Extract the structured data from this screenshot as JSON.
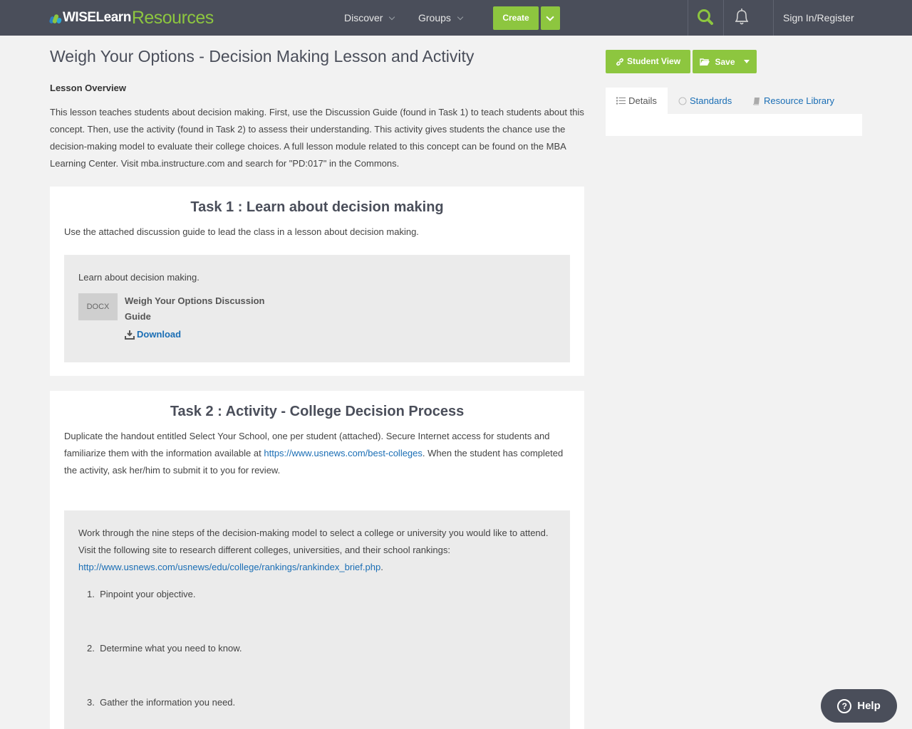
{
  "header": {
    "logo_wise": "WISELearn",
    "logo_resources": "Resources",
    "nav": [
      {
        "label": "Discover"
      },
      {
        "label": "Groups"
      }
    ],
    "create_label": "Create",
    "signin_label": "Sign In/Register"
  },
  "lesson": {
    "title": "Weigh Your Options - Decision Making Lesson and Activity",
    "overview_heading": "Lesson Overview",
    "overview_text": "This lesson teaches students about decision making. First, use the Discussion Guide (found in Task 1) to teach students about this concept. Then, use the activity (found in Task 2) to assess their understanding. This activity gives students the chance use the decision-making model to evaluate their college choices. A full lesson module related to this concept can be found on the MBA Learning Center. Visit mba.instructure.com and search for \"PD:017\" in the Commons."
  },
  "task1": {
    "title": "Task 1 : Learn about decision making",
    "description": "Use the attached discussion guide to lead the class in a lesson about decision making.",
    "box_text": "Learn about decision making.",
    "file_type": "DOCX",
    "file_name": "Weigh Your Options Discussion Guide",
    "download_label": "Download"
  },
  "task2": {
    "title": "Task 2 : Activity - College Decision Process",
    "desc_part1": "Duplicate the handout entitled Select Your School, one per student (attached). Secure Internet access for students and familiarize them with the information available at ",
    "desc_link": "https://www.usnews.com/best-colleges",
    "desc_part2": ". When the student has completed the activity, ask her/him to submit it to you for review.",
    "box_intro": "Work through the nine steps of the decision-making model to select a college or university you would like to attend. Visit the following site to research different colleges, universities, and their school rankings: ",
    "box_link": "http://www.usnews.com/usnews/edu/college/rankings/rankindex_brief.php",
    "box_link_suffix": ".",
    "steps": [
      {
        "num": "1.",
        "text": "Pinpoint your objective."
      },
      {
        "num": "2.",
        "text": "Determine what you need to know."
      },
      {
        "num": "3.",
        "text": "Gather the information you need."
      }
    ]
  },
  "sidebar": {
    "student_view_label": "Student View",
    "save_label": "Save",
    "tabs": [
      {
        "label": "Details"
      },
      {
        "label": "Standards"
      },
      {
        "label": "Resource Library"
      }
    ]
  },
  "help": {
    "label": "Help"
  },
  "colors": {
    "header_bg": "#4a4e5a",
    "accent_green": "#8dc63f",
    "link_blue": "#1a6eb5"
  }
}
